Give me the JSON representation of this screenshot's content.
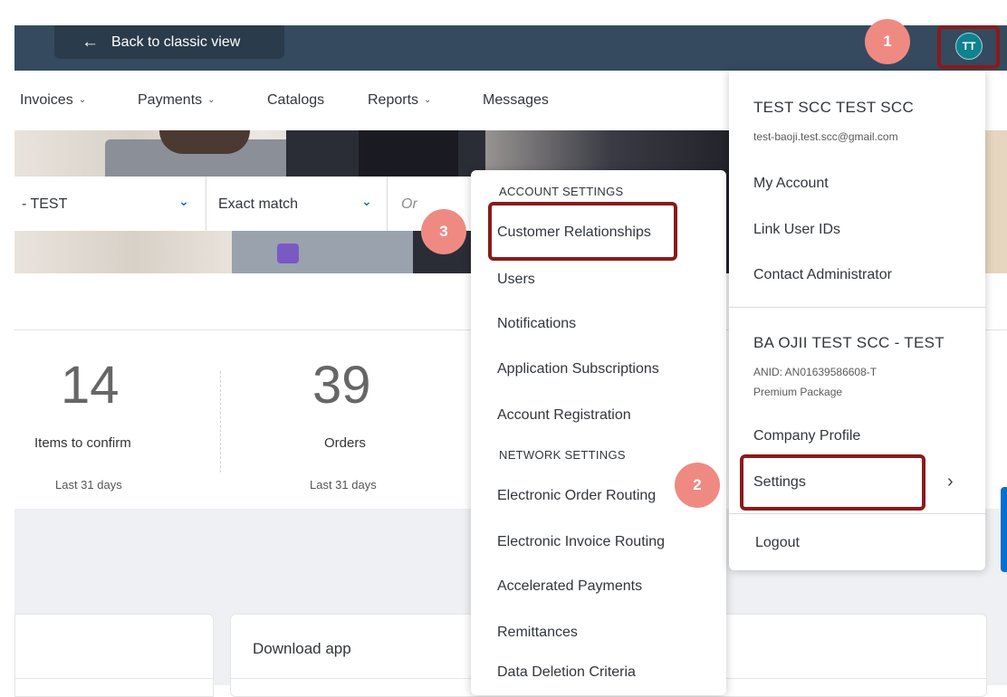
{
  "shell": {
    "back_label": "Back to classic view",
    "avatar_initials": "TT"
  },
  "nav": {
    "items": [
      {
        "label": "Invoices"
      },
      {
        "label": "Payments"
      },
      {
        "label": "Catalogs"
      },
      {
        "label": "Reports"
      },
      {
        "label": "Messages"
      }
    ]
  },
  "filter": {
    "account_value": "- TEST",
    "match_value": "Exact match",
    "order_placeholder": "Or"
  },
  "tiles": [
    {
      "count": "14",
      "label": "Items to confirm",
      "period": "Last 31 days"
    },
    {
      "count": "39",
      "label": "Orders",
      "period": "Last 31 days"
    }
  ],
  "cards": {
    "download_title": "Download app"
  },
  "settings_menu": {
    "account_section": "ACCOUNT SETTINGS",
    "account_items": [
      "Customer Relationships",
      "Users",
      "Notifications",
      "Application Subscriptions",
      "Account Registration"
    ],
    "network_section": "NETWORK SETTINGS",
    "network_items": [
      "Electronic Order Routing",
      "Electronic Invoice Routing",
      "Accelerated Payments",
      "Remittances",
      "Data Deletion Criteria"
    ]
  },
  "user_menu": {
    "name": "TEST SCC TEST SCC",
    "email": "test-baoji.test.scc@gmail.com",
    "items": [
      "My Account",
      "Link User IDs",
      "Contact Administrator"
    ],
    "company_name": "BA OJII TEST SCC - TEST",
    "anid": "ANID: AN01639586608-T",
    "package": "Premium Package",
    "company_items": [
      "Company Profile",
      "Settings"
    ],
    "logout": "Logout"
  },
  "annotations": {
    "step1": "1",
    "step2": "2",
    "step3": "3",
    "badge_color": "#ef8a83",
    "highlight_color": "#8b1a1a"
  },
  "colors": {
    "shellbar": "#354a5f",
    "avatar": "#0f828f",
    "accent": "#0a6ed1"
  }
}
